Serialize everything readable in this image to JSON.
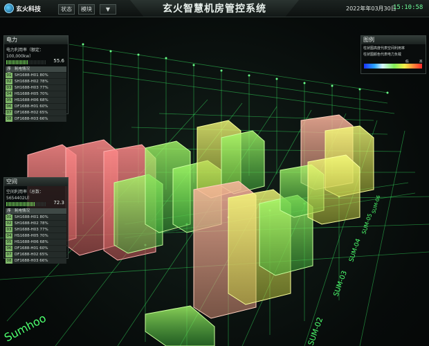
{
  "app": {
    "title": "玄火智慧机房管控系统",
    "logo_text": "玄火科技",
    "date": "2022年年03月30日",
    "time": "15:10:58"
  },
  "toolbar": {
    "tabs": [
      {
        "label": "状态"
      },
      {
        "label": "模块"
      },
      {
        "label": "▼"
      }
    ]
  },
  "power_panel": {
    "title": "电力",
    "metric_label": "电力利用率（额定：100,000kw）",
    "metric_value": "55.6",
    "metric_percent": 55.6,
    "table_header": [
      "序号",
      "耗电情况"
    ],
    "rows": [
      {
        "idx": "01",
        "text": "SH1688-H01 80%"
      },
      {
        "idx": "02",
        "text": "SH1688-H02 78%"
      },
      {
        "idx": "03",
        "text": "SH1688-H03 77%"
      },
      {
        "idx": "04",
        "text": "HS1688-H05 70%"
      },
      {
        "idx": "05",
        "text": "HS1688-H06 68%"
      },
      {
        "idx": "06",
        "text": "DF1688-H01 60%"
      },
      {
        "idx": "07",
        "text": "DF1688-H02 65%"
      },
      {
        "idx": "08",
        "text": "DF1688-H03 66%"
      }
    ]
  },
  "space_panel": {
    "title": "空间",
    "metric_label": "空间利用率（总数：5654402U）",
    "metric_value": "72.3",
    "metric_percent": 72.3,
    "table_header": [
      "序号",
      "耗电情况"
    ],
    "rows": [
      {
        "idx": "01",
        "text": "SH1688-H01 80%"
      },
      {
        "idx": "02",
        "text": "SH1688-H02 78%"
      },
      {
        "idx": "03",
        "text": "SH1688-H03 77%"
      },
      {
        "idx": "04",
        "text": "HS1688-H05 70%"
      },
      {
        "idx": "05",
        "text": "HS1688-H06 68%"
      },
      {
        "idx": "06",
        "text": "DF1688-H01 60%"
      },
      {
        "idx": "07",
        "text": "DF1688-H02 65%"
      },
      {
        "idx": "08",
        "text": "DF1688-H03 66%"
      }
    ]
  },
  "legend_panel": {
    "title": "图例",
    "line1": "柱状图高度代表空间利用率",
    "line2": "柱状图颜色代表电力负载",
    "ticks": [
      "低",
      "",
      "高"
    ]
  },
  "scene_labels": {
    "floor_labels": [
      "Sumhoo",
      "SUM-02",
      "SUM-03",
      "SUM-04",
      "SUM-05",
      "SUM-06"
    ],
    "colors": {
      "grid": "#3cff6a",
      "low_load": "#7dff5c",
      "mid_load": "#f5ff5a",
      "high_load": "#ff6a6a"
    }
  }
}
